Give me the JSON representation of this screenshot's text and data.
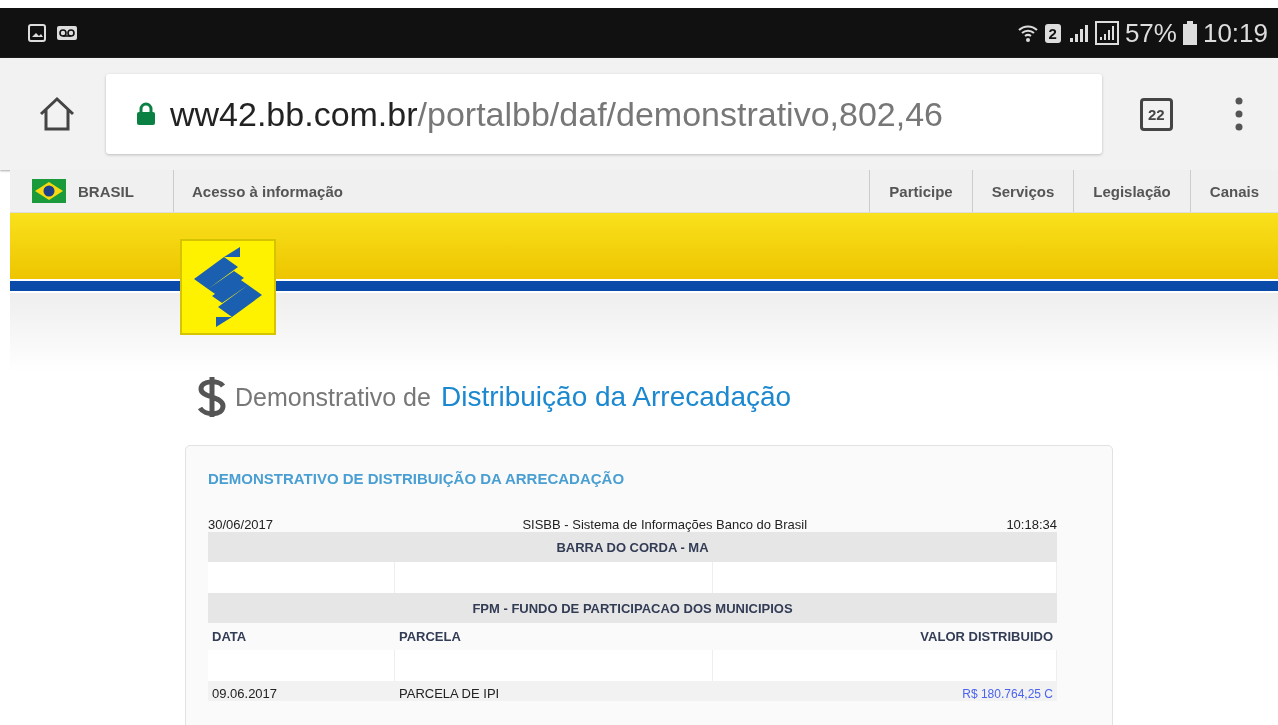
{
  "status_bar": {
    "sim_slot": "2",
    "battery": "57%",
    "time": "10:19"
  },
  "browser": {
    "url_host": "ww42.bb.com.br",
    "url_path": "/portalbb/daf/demonstrativo,802,46",
    "tab_count": "22"
  },
  "gov_bar": {
    "country": "BRASIL",
    "access": "Acesso à informação",
    "links": [
      "Participe",
      "Serviços",
      "Legislação",
      "Canais"
    ]
  },
  "page_title": {
    "lead": "Demonstrativo de",
    "main": "Distribuição da Arrecadação"
  },
  "report": {
    "title": "DEMONSTRATIVO DE DISTRIBUIÇÃO DA ARRECADAÇÃO",
    "date": "30/06/2017",
    "system": "SISBB - Sistema de Informações Banco do Brasil",
    "time": "10:18:34",
    "rows": [
      {
        "kind": "section",
        "text": "BARRA DO CORDA - MA"
      },
      {
        "kind": "blank"
      },
      {
        "kind": "section",
        "text": "FPM - FUNDO DE PARTICIPACAO DOS MUNICIPIOS"
      },
      {
        "kind": "header",
        "cells": [
          "DATA",
          "PARCELA",
          "VALOR DISTRIBUIDO"
        ]
      },
      {
        "kind": "blank"
      },
      {
        "kind": "data",
        "cells": [
          "09.06.2017",
          "PARCELA DE IPI",
          "R$ 180.764,25 C"
        ]
      }
    ]
  }
}
